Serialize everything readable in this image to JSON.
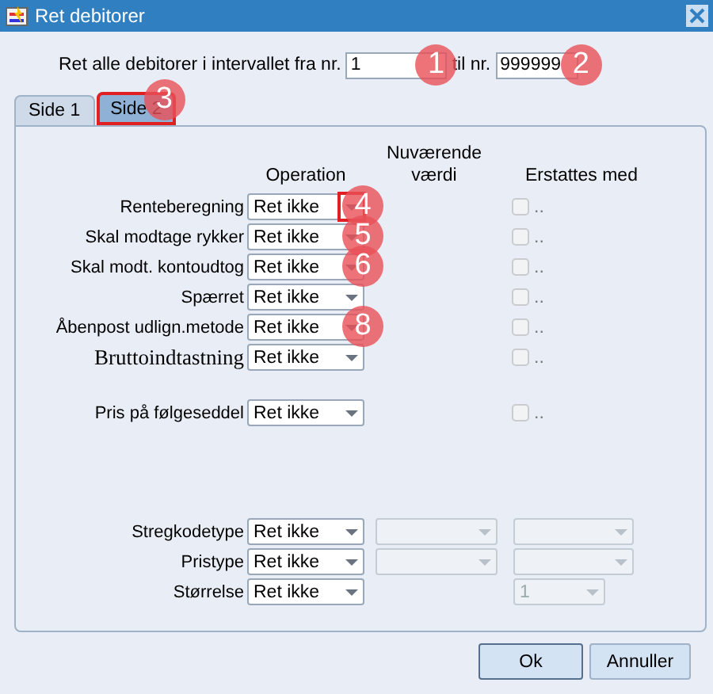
{
  "window": {
    "title": "Ret debitorer"
  },
  "range": {
    "label": "Ret alle debitorer i intervallet fra nr.",
    "from_value": "1",
    "from_marker": "1",
    "to_label": "til nr.",
    "to_value": "999999",
    "to_marker": "2"
  },
  "tabs": [
    {
      "label": "Side 1",
      "selected": false,
      "highlighted": false
    },
    {
      "label": "Side 2",
      "selected": true,
      "highlighted": true,
      "marker": "3"
    }
  ],
  "headers": {
    "operation": "Operation",
    "current": "Nuværende værdi",
    "replace": "Erstattes med"
  },
  "sections": [
    {
      "rows": [
        {
          "kind": "check",
          "label": "Renteberegning",
          "emphasized": false,
          "operation": "Ret ikke",
          "arrow_highlighted": true,
          "marker": "4",
          "replace": {
            "checked": false,
            "text": ".."
          }
        },
        {
          "kind": "check",
          "label": "Skal modtage rykker",
          "emphasized": false,
          "operation": "Ret ikke",
          "arrow_highlighted": false,
          "marker": "5",
          "replace": {
            "checked": false,
            "text": ".."
          }
        },
        {
          "kind": "check",
          "label": "Skal modt. kontoudtog",
          "emphasized": false,
          "operation": "Ret ikke",
          "arrow_highlighted": false,
          "marker": "6",
          "replace": {
            "checked": false,
            "text": ".."
          }
        },
        {
          "kind": "check",
          "label": "Spærret",
          "emphasized": false,
          "operation": "Ret ikke",
          "arrow_highlighted": false,
          "replace": {
            "checked": false,
            "text": ".."
          }
        },
        {
          "kind": "check",
          "label": "Åbenpost udlign.metode",
          "emphasized": false,
          "operation": "Ret ikke",
          "arrow_highlighted": false,
          "marker": "8",
          "replace": {
            "checked": false,
            "text": ".."
          }
        },
        {
          "kind": "check",
          "label": "Bruttoindtastning",
          "emphasized": true,
          "operation": "Ret ikke",
          "arrow_highlighted": false,
          "replace": {
            "checked": false,
            "text": ".."
          }
        }
      ]
    },
    {
      "rows": [
        {
          "kind": "check",
          "label": "Pris på følgeseddel",
          "emphasized": false,
          "operation": "Ret ikke",
          "arrow_highlighted": false,
          "replace": {
            "checked": false,
            "text": ".."
          }
        }
      ]
    },
    {
      "rows": [
        {
          "kind": "combo",
          "label": "Stregkodetype",
          "emphasized": false,
          "operation": "Ret ikke",
          "arrow_highlighted": false,
          "current": {
            "enabled": false
          },
          "replace": {
            "enabled": false,
            "narrow": false
          }
        },
        {
          "kind": "combo",
          "label": "Pristype",
          "emphasized": false,
          "operation": "Ret ikke",
          "arrow_highlighted": false,
          "current": {
            "enabled": false
          },
          "replace": {
            "enabled": false,
            "narrow": false
          }
        },
        {
          "kind": "combo",
          "label": "Størrelse",
          "emphasized": false,
          "operation": "Ret ikke",
          "arrow_highlighted": false,
          "replace": {
            "enabled": false,
            "value": "1",
            "narrow": true
          }
        }
      ]
    }
  ],
  "buttons": [
    {
      "label": "Ok",
      "default": true
    },
    {
      "label": "Annuller",
      "default": false
    }
  ]
}
